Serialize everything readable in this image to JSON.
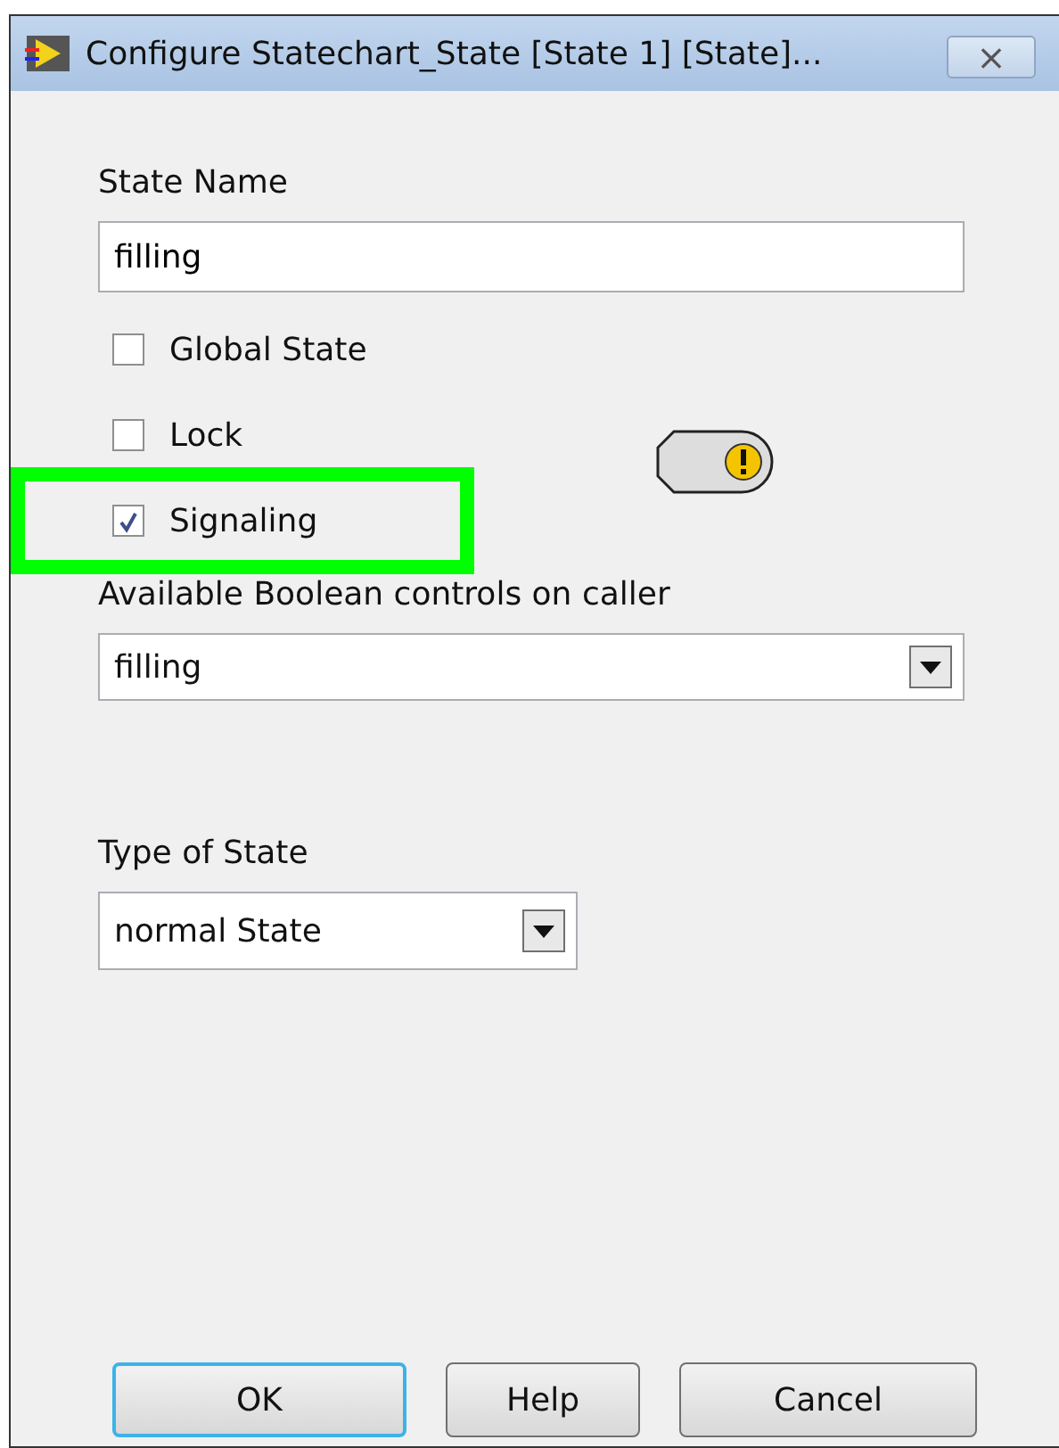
{
  "window": {
    "title": "Configure Statechart_State [State 1] [State]...",
    "close": "×"
  },
  "state_name": {
    "label": "State Name",
    "value": "filling"
  },
  "options": [
    {
      "label": "Global State",
      "checked": false,
      "highlighted": false
    },
    {
      "label": "Lock",
      "checked": false,
      "highlighted": false
    },
    {
      "label": "Signaling",
      "checked": true,
      "highlighted": true
    }
  ],
  "indicator": {
    "kind": "warning"
  },
  "boolean_controls": {
    "label": "Available Boolean controls on caller",
    "value": "filling"
  },
  "state_type": {
    "label": "Type of State",
    "value": "normal State"
  },
  "buttons": [
    {
      "label": "OK",
      "default": true
    },
    {
      "label": "Help",
      "default": false
    },
    {
      "label": "Cancel",
      "default": false
    }
  ]
}
